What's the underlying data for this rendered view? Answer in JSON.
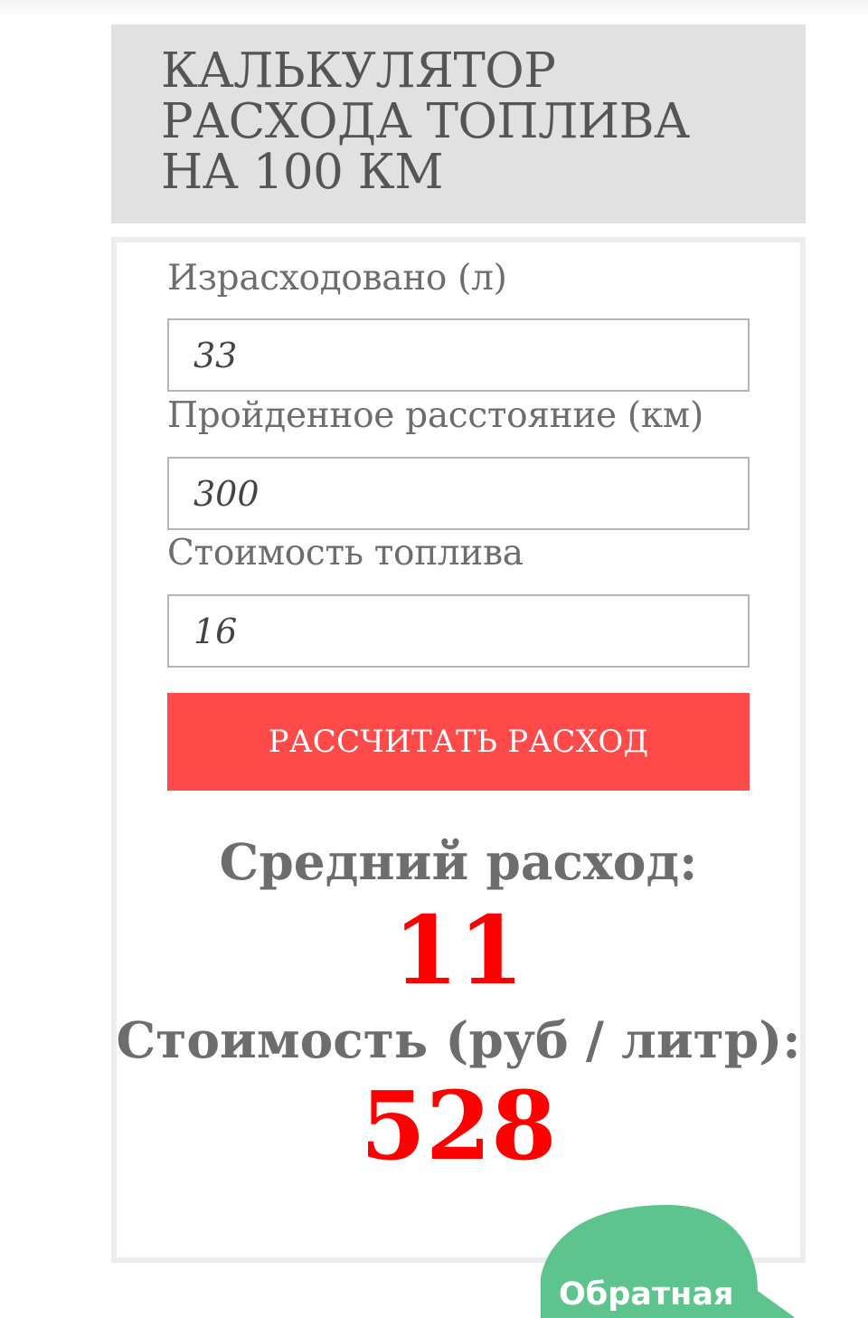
{
  "header": {
    "title": "КАЛЬКУЛЯТОР\nРАСХОДА ТОПЛИВА\nНА 100 КМ"
  },
  "form": {
    "fuel_used": {
      "label": "Израсходовано (л)",
      "value": "33"
    },
    "distance": {
      "label": "Пройденное расстояние (км)",
      "value": "300"
    },
    "fuel_cost": {
      "label": "Стоимость топлива",
      "value": "16"
    },
    "submit_label": "РАССЧИТАТЬ РАСХОД"
  },
  "results": {
    "avg_label": "Средний расход:",
    "avg_value": "11",
    "cost_label": "Стоимость (руб / литр):",
    "cost_value": "528"
  },
  "feedback": {
    "label": "Обратная",
    "color": "#5ec48e"
  },
  "colors": {
    "accent": "#ff4a4a",
    "result": "#ff0000",
    "header_bg": "#e1e1e1"
  }
}
